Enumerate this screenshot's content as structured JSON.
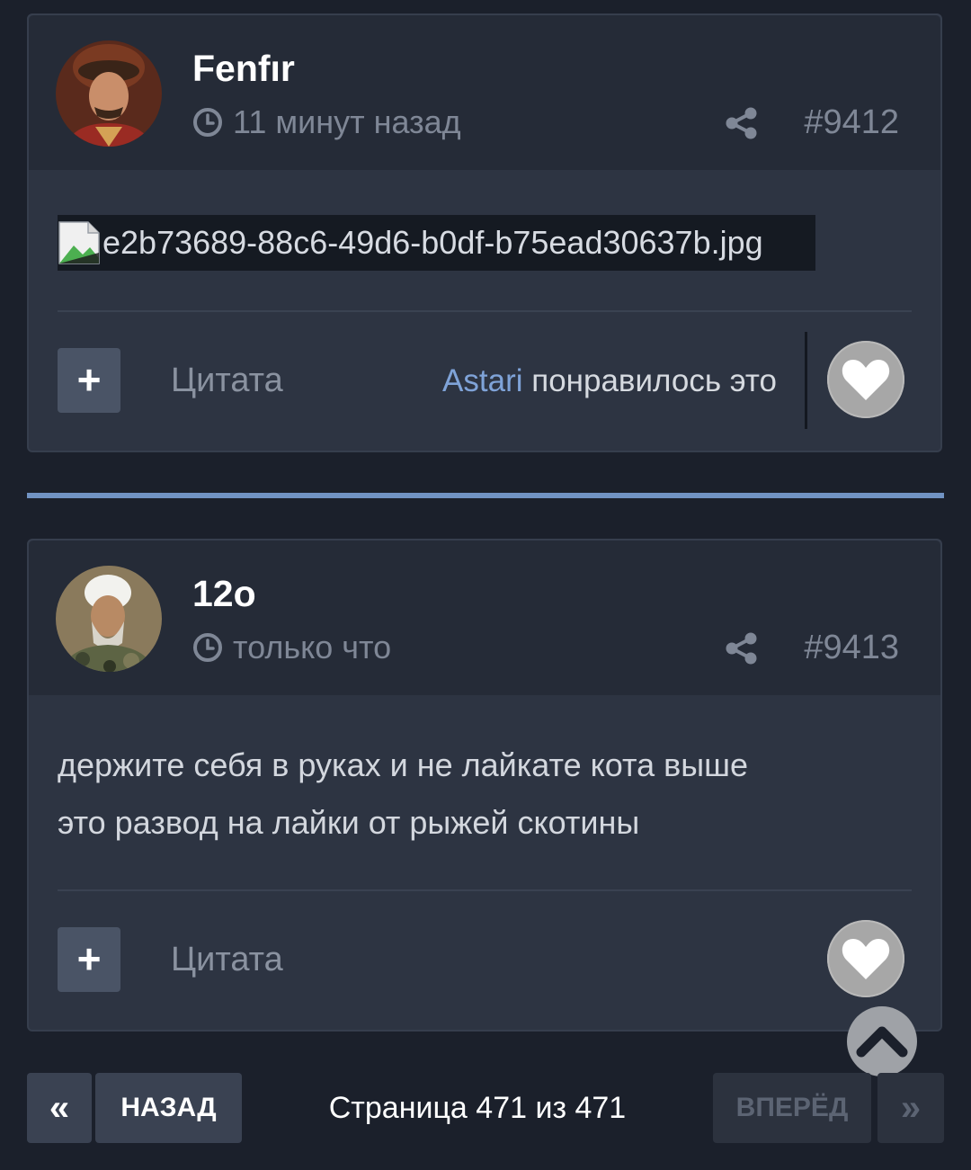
{
  "posts": [
    {
      "author": "Fenfır",
      "time": "11 минут назад",
      "number": "#9412",
      "image_filename": "e2b73689-88c6-49d6-b0df-b75ead30637b.jpg",
      "quote_label": "Цитата",
      "liker": "Astari",
      "likes_suffix": " понравилось это",
      "avatar_icon": "avatar-portrait-icon"
    },
    {
      "author": "12о",
      "time": "только что",
      "number": "#9413",
      "text": "держите себя в руках и не лайкате кота выше\nэто развод на лайки от рыжей скотины",
      "quote_label": "Цитата",
      "avatar_icon": "avatar-portrait-icon"
    }
  ],
  "pagination": {
    "first_label": "«",
    "prev_label": "НАЗАД",
    "page_info": "Страница 471 из 471",
    "next_label": "ВПЕРЁД",
    "last_label": "»"
  },
  "icons": {
    "clock": "clock-icon",
    "share": "share-icon",
    "plus": "+",
    "heart": "heart-icon",
    "scroll_top": "chevron-up-icon"
  },
  "colors": {
    "page_bg": "#1b202b",
    "post_bg": "#2d3442",
    "header_bg": "#252b37",
    "accent": "#7193c3",
    "link": "#7fa3d8"
  }
}
